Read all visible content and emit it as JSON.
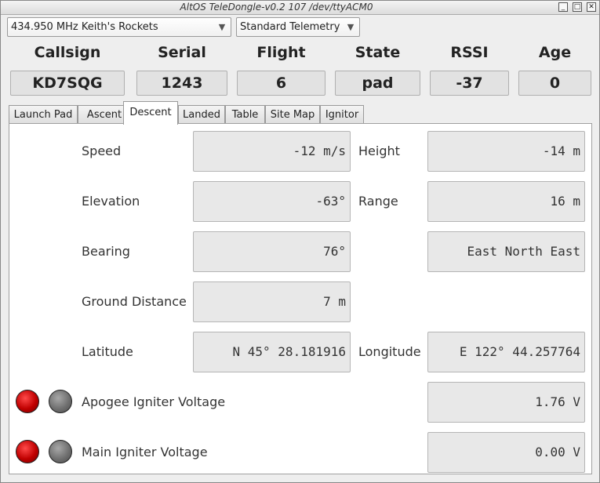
{
  "window": {
    "title": "AltOS TeleDongle-v0.2 107 /dev/ttyACM0",
    "controls": {
      "minimize": "_",
      "maximize": "□",
      "close": "✕"
    }
  },
  "toolbar": {
    "frequency_selected": "434.950 MHz Keith's Rockets",
    "telemetry_selected": "Standard Telemetry",
    "dropdown_icon": "chevron-down-icon"
  },
  "status": {
    "headers": [
      "Callsign",
      "Serial",
      "Flight",
      "State",
      "RSSI",
      "Age"
    ],
    "values": [
      "KD7SQG",
      "1243",
      "6",
      "pad",
      "-37",
      "0"
    ]
  },
  "tabs": [
    {
      "label": "Launch Pad",
      "active": false
    },
    {
      "label": "Ascent",
      "active": false
    },
    {
      "label": "Descent",
      "active": true
    },
    {
      "label": "Landed",
      "active": false
    },
    {
      "label": "Table",
      "active": false
    },
    {
      "label": "Site Map",
      "active": false
    },
    {
      "label": "Ignitor",
      "active": false
    }
  ],
  "descent": {
    "speed": {
      "label": "Speed",
      "value": "-12 m/s"
    },
    "height": {
      "label": "Height",
      "value": "-14 m"
    },
    "elevation": {
      "label": "Elevation",
      "value": "-63°"
    },
    "range": {
      "label": "Range",
      "value": "16 m"
    },
    "bearing": {
      "label": "Bearing",
      "value": "76°",
      "compass": "East North East"
    },
    "ground_distance": {
      "label": "Ground Distance",
      "value": "7 m"
    },
    "latitude": {
      "label": "Latitude",
      "value": "N 45° 28.181916"
    },
    "longitude": {
      "label": "Longitude",
      "value": "E 122° 44.257764"
    },
    "apogee": {
      "label": "Apogee Igniter Voltage",
      "value": "1.76 V"
    },
    "main": {
      "label": "Main Igniter Voltage",
      "value": "0.00 V"
    }
  },
  "colors": {
    "led_red": "#c00000",
    "led_gray": "#707070",
    "panel_bg": "#ffffff",
    "window_bg": "#eeeeee"
  }
}
